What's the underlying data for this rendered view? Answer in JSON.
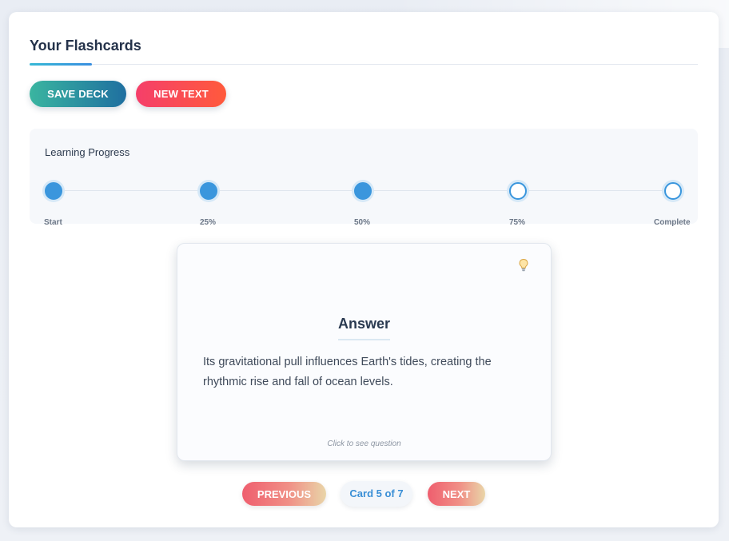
{
  "header": {
    "title": "Your Flashcards"
  },
  "toolbar": {
    "save_label": "SAVE DECK",
    "new_text_label": "NEW TEXT"
  },
  "progress": {
    "title": "Learning Progress",
    "completed_fraction": 0.5,
    "steps": [
      {
        "label": "Start",
        "completed": true
      },
      {
        "label": "25%",
        "completed": true
      },
      {
        "label": "50%",
        "completed": true
      },
      {
        "label": "75%",
        "completed": false
      },
      {
        "label": "Complete",
        "completed": false
      }
    ]
  },
  "card": {
    "heading": "Answer",
    "body": "Its gravitational pull influences Earth's tides, creating the rhythmic rise and fall of ocean levels.",
    "footer_hint": "Click to see question",
    "hint_icon": "lightbulb-icon"
  },
  "navigation": {
    "previous_label": "PREVIOUS",
    "next_label": "NEXT",
    "counter": "Card 5 of 7"
  },
  "colors": {
    "accent": "#3a96dd",
    "title_text": "#24324a",
    "save_gradient_start": "#3ab5a0",
    "save_gradient_end": "#1f6fa0",
    "new_text_gradient_start": "#f53f6a",
    "new_text_gradient_end": "#ff5a3c"
  }
}
